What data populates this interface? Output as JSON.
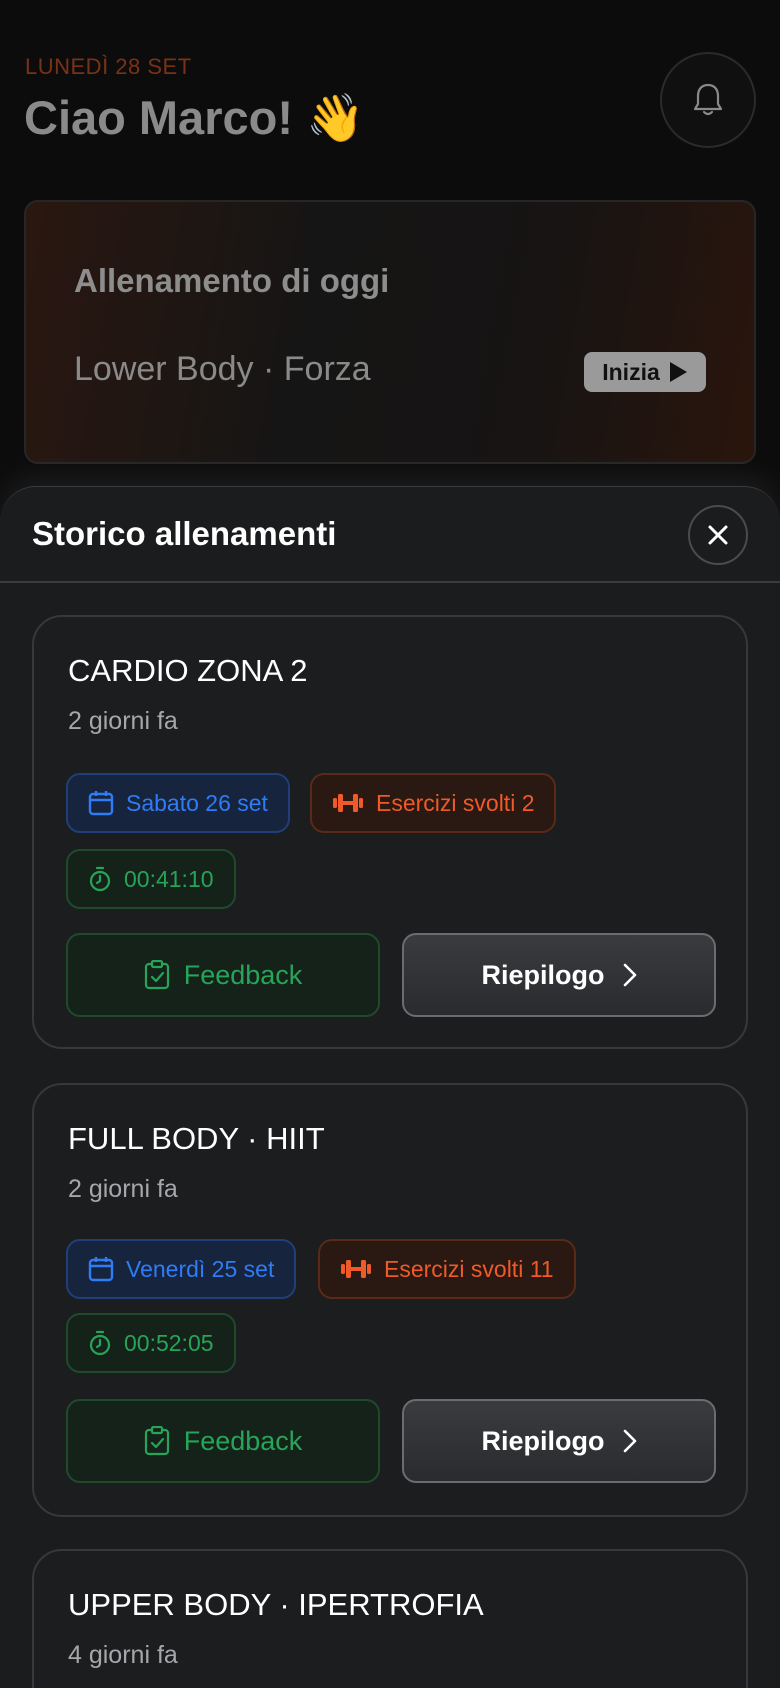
{
  "home": {
    "date": "LUNEDÌ 28 SET",
    "greeting": "Ciao Marco! 👋",
    "today_card": {
      "title": "Allenamento di oggi",
      "subtitle": "Lower Body · Forza",
      "start_label": "Inizia"
    }
  },
  "sheet": {
    "title": "Storico allenamenti",
    "workouts": [
      {
        "title": "CARDIO ZONA 2",
        "ago": "2 giorni fa",
        "date": "Sabato 26 set",
        "exercises": "Esercizi svolti 2",
        "duration": "00:41:10",
        "feedback_label": "Feedback",
        "summary_label": "Riepilogo"
      },
      {
        "title": "FULL BODY · HIIT",
        "ago": "2 giorni fa",
        "date": "Venerdì 25 set",
        "exercises": "Esercizi svolti 11",
        "duration": "00:52:05",
        "feedback_label": "Feedback",
        "summary_label": "Riepilogo"
      },
      {
        "title": "UPPER BODY · IPERTROFIA",
        "ago": "4 giorni fa"
      }
    ]
  },
  "colors": {
    "accent_orange": "#f05a28",
    "accent_blue": "#2f7cf6",
    "accent_green": "#27a458",
    "sheet_bg": "#1b1c1e"
  }
}
